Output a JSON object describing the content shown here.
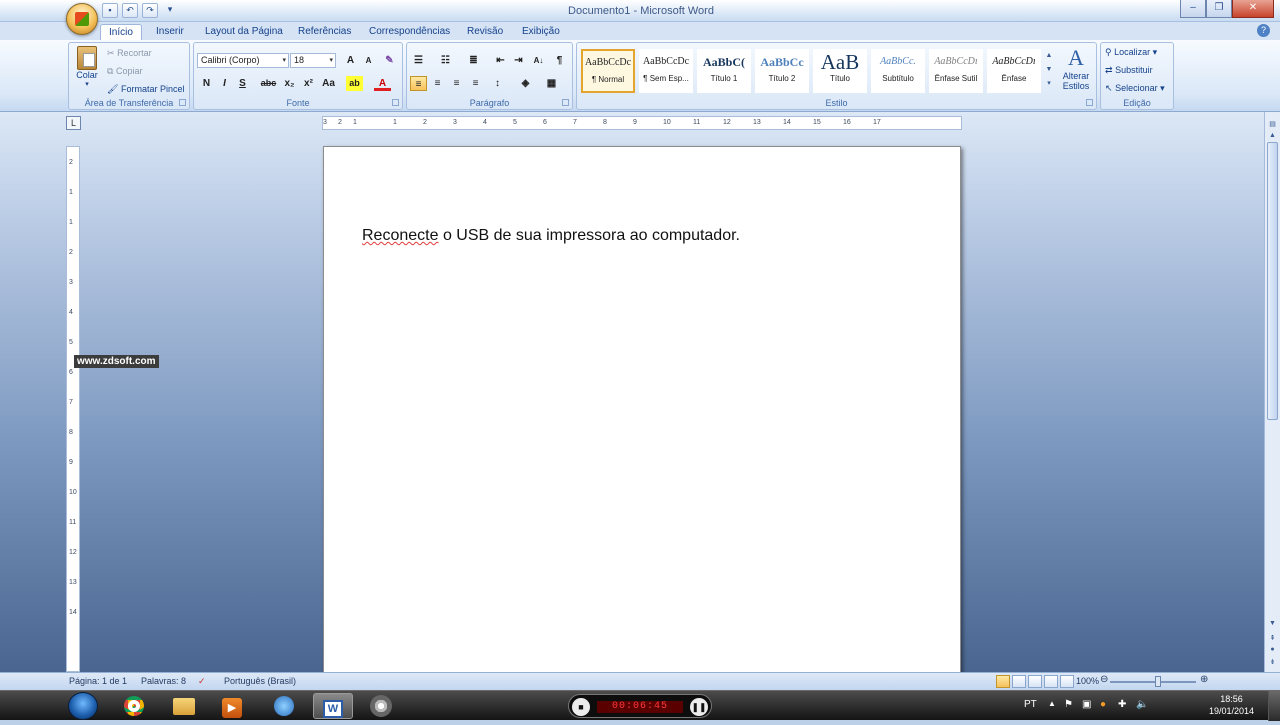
{
  "window": {
    "title": "Documento1 - Microsoft Word",
    "min": "–",
    "max": "❐",
    "close": "✕"
  },
  "qat": {
    "save_icon": "save-icon",
    "undo_icon": "undo-icon",
    "redo_icon": "redo-icon",
    "customize_icon": "chevron-down-icon"
  },
  "tabs": [
    "Início",
    "Inserir",
    "Layout da Página",
    "Referências",
    "Correspondências",
    "Revisão",
    "Exibição"
  ],
  "active_tab": "Início",
  "clipboard": {
    "paste": "Colar",
    "cut": "Recortar",
    "copy": "Copiar",
    "format_painter": "Formatar Pincel",
    "label": "Área de Transferência"
  },
  "font": {
    "family": "Calibri (Corpo)",
    "size": "18",
    "grow": "A",
    "shrink": "A",
    "clear": "✎",
    "bold": "N",
    "italic": "I",
    "underline": "S",
    "strike": "abc",
    "sub": "x₂",
    "sup": "x²",
    "case": "Aa",
    "highlight": "ab",
    "color": "A",
    "label": "Fonte"
  },
  "paragraph": {
    "label": "Parágrafo",
    "pilcrow": "¶",
    "sort": "A↓"
  },
  "styles": {
    "label": "Estilo",
    "items": [
      {
        "preview": "AaBbCcDc",
        "name": "¶ Normal"
      },
      {
        "preview": "AaBbCcDc",
        "name": "¶ Sem Esp..."
      },
      {
        "preview": "AaBbC(",
        "name": "Título 1"
      },
      {
        "preview": "AaBbCc",
        "name": "Título 2"
      },
      {
        "preview": "AaB",
        "name": "Título"
      },
      {
        "preview": "AaBbCc.",
        "name": "Subtítulo"
      },
      {
        "preview": "AaBbCcDı",
        "name": "Ênfase Sutil"
      },
      {
        "preview": "AaBbCcDı",
        "name": "Ênfase"
      }
    ],
    "change_styles_line1": "Alterar",
    "change_styles_line2": "Estilos"
  },
  "editing": {
    "find": "Localizar",
    "replace": "Substituir",
    "select": "Selecionar",
    "label": "Edição"
  },
  "ruler": {
    "h_ticks": [
      "3",
      "2",
      "1",
      "1",
      "2",
      "3",
      "4",
      "5",
      "6",
      "7",
      "8",
      "9",
      "10",
      "11",
      "12",
      "13",
      "14",
      "15",
      "16",
      "17"
    ],
    "v_ticks": [
      "2",
      "1",
      "1",
      "2",
      "3",
      "4",
      "5",
      "6",
      "7",
      "8",
      "9",
      "10",
      "11",
      "12",
      "13",
      "14"
    ]
  },
  "document": {
    "word1": "Reconecte",
    "rest": " o USB de sua impressora ao computador."
  },
  "watermark": "www.zdsoft.com",
  "status": {
    "page": "Página: 1 de 1",
    "words": "Palavras: 8",
    "language": "Português (Brasil)",
    "zoom": "100%"
  },
  "taskbar": {
    "recorder_time": "00:06:45",
    "lang": "PT",
    "time": "18:56",
    "date": "19/01/2014"
  }
}
